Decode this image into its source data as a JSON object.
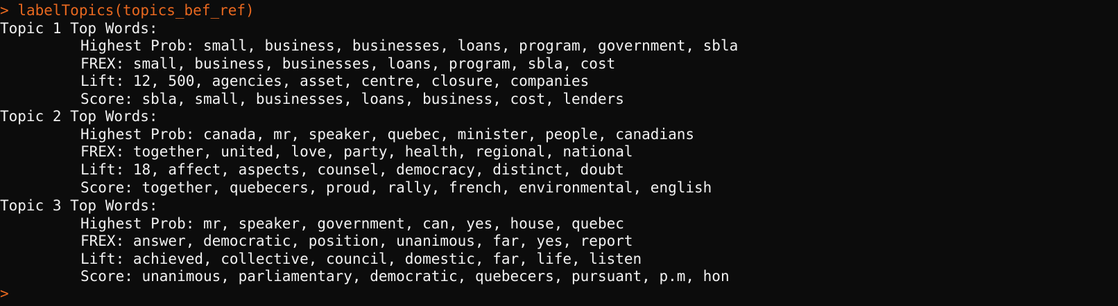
{
  "console": {
    "prompt_symbol": ">",
    "command": "labelTopics(topics_bef_ref)",
    "topics": [
      {
        "header": "Topic 1 Top Words:",
        "rows": [
          "Highest Prob: small, business, businesses, loans, program, government, sbla",
          "FREX: small, business, businesses, loans, program, sbla, cost",
          "Lift: 12, 500, agencies, asset, centre, closure, companies",
          "Score: sbla, small, businesses, loans, business, cost, lenders"
        ]
      },
      {
        "header": "Topic 2 Top Words:",
        "rows": [
          "Highest Prob: canada, mr, speaker, quebec, minister, people, canadians",
          "FREX: together, united, love, party, health, regional, national",
          "Lift: 18, affect, aspects, counsel, democracy, distinct, doubt",
          "Score: together, quebecers, proud, rally, french, environmental, english"
        ]
      },
      {
        "header": "Topic 3 Top Words:",
        "rows": [
          "Highest Prob: mr, speaker, government, can, yes, house, quebec",
          "FREX: answer, democratic, position, unanimous, far, yes, report",
          "Lift: achieved, collective, council, domestic, far, life, listen",
          "Score: unanimous, parliamentary, democratic, quebecers, pursuant, p.m, hon"
        ]
      }
    ],
    "colors": {
      "background": "#0c0c0c",
      "text": "#f2f2f2",
      "command": "#e8681f"
    }
  }
}
